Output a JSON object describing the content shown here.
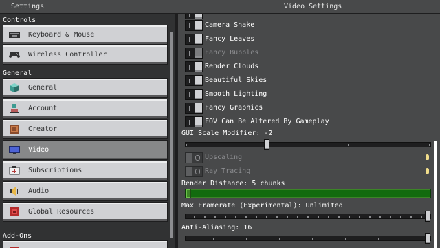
{
  "header": {
    "left_title": "Settings",
    "right_title": "Video Settings"
  },
  "sidebar": {
    "sections": [
      {
        "label": "Controls"
      },
      {
        "label": "General"
      },
      {
        "label": "Add-Ons"
      }
    ],
    "items": [
      {
        "label": "Keyboard & Mouse",
        "icon": "keyboard-icon"
      },
      {
        "label": "Wireless Controller",
        "icon": "gamepad-icon"
      },
      {
        "label": "General",
        "icon": "cube-icon"
      },
      {
        "label": "Account",
        "icon": "person-icon"
      },
      {
        "label": "Creator",
        "icon": "creator-icon"
      },
      {
        "label": "Video",
        "icon": "monitor-icon",
        "selected": true
      },
      {
        "label": "Subscriptions",
        "icon": "subscriptions-icon"
      },
      {
        "label": "Audio",
        "icon": "speaker-icon"
      },
      {
        "label": "Global Resources",
        "icon": "resource-pack-icon"
      }
    ]
  },
  "video": {
    "toggles": [
      {
        "label": "Camera Shake",
        "enabled": false
      },
      {
        "label": "Fancy Leaves",
        "enabled": false
      },
      {
        "label": "Fancy Bubbles",
        "enabled": false,
        "disabled": true
      },
      {
        "label": "Render Clouds",
        "enabled": false
      },
      {
        "label": "Beautiful Skies",
        "enabled": false
      },
      {
        "label": "Smooth Lighting",
        "enabled": false
      },
      {
        "label": "Fancy Graphics",
        "enabled": false
      },
      {
        "label": "FOV Can Be Altered By Gameplay",
        "enabled": false
      }
    ],
    "gui_scale": {
      "label": "GUI Scale Modifier: -2",
      "value_fraction": 0.33
    },
    "upscaling": {
      "label": "Upscaling",
      "enabled": false,
      "unavailable": true
    },
    "ray_tracing": {
      "label": "Ray Tracing",
      "enabled": false,
      "unavailable": true
    },
    "render_distance": {
      "label": "Render Distance: 5 chunks",
      "value_fraction": 0.0
    },
    "max_framerate": {
      "label": "Max Framerate (Experimental): Unlimited",
      "value_fraction": 1.0
    },
    "anti_aliasing": {
      "label": "Anti-Aliasing: 16",
      "value_fraction": 1.0
    }
  },
  "colors": {
    "accent_green": "#3c8527",
    "button_face": "#d0d1d4",
    "panel_bg": "#48494a",
    "info_yellow": "#f1dd8b"
  }
}
